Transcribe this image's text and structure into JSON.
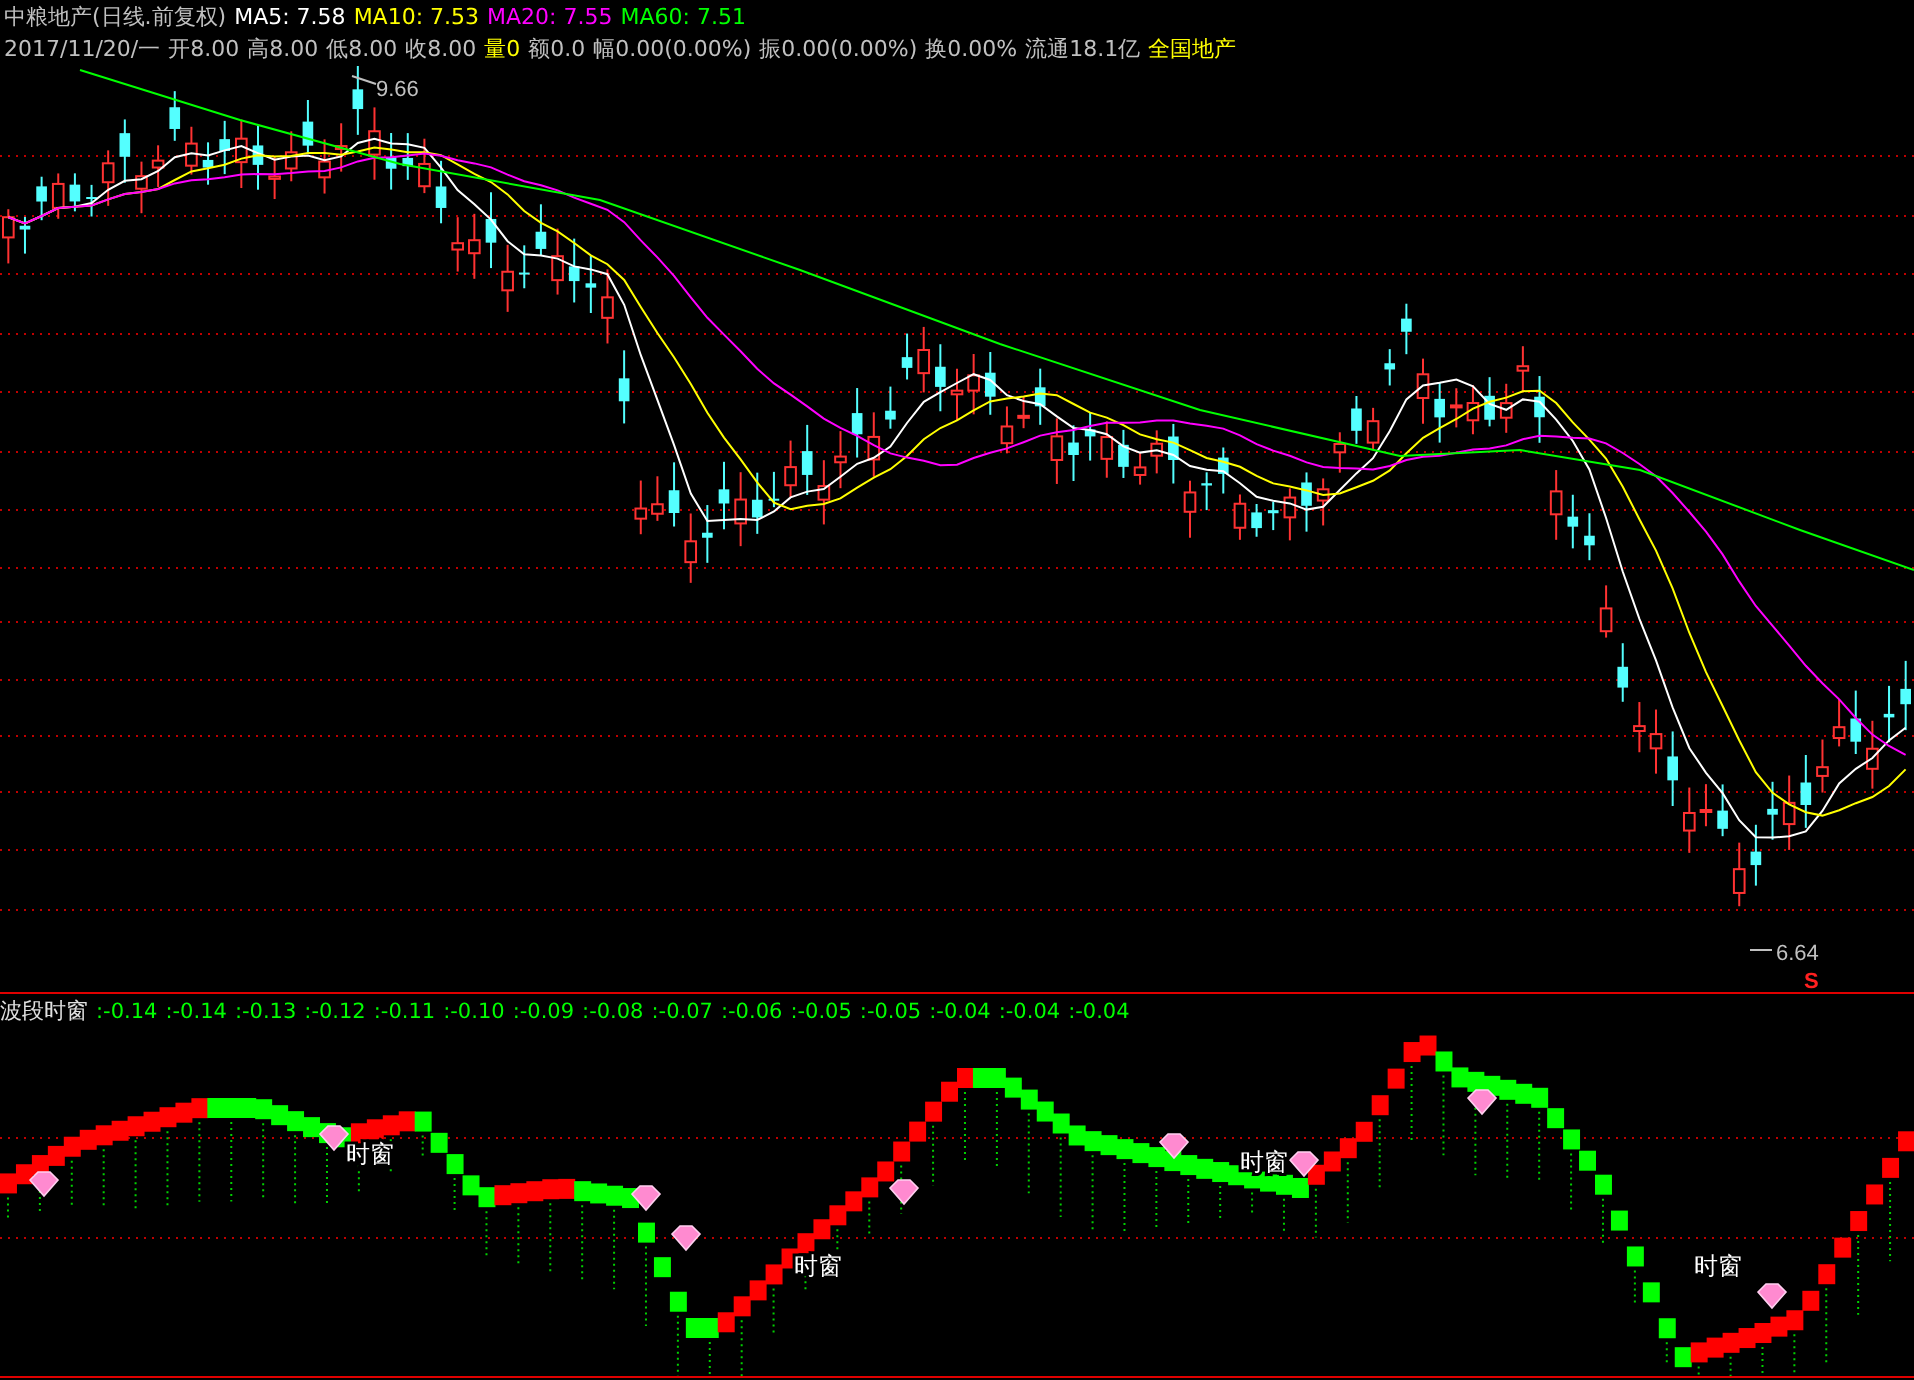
{
  "header": {
    "title": "中粮地产(日线.前复权)",
    "moving_averages": [
      {
        "label": "MA5: 7.58",
        "color": "#ffffff"
      },
      {
        "label": "MA10: 7.53",
        "color": "#ffff00"
      },
      {
        "label": "MA20: 7.55",
        "color": "#ff00ff"
      },
      {
        "label": "MA60: 7.51",
        "color": "#00ff00"
      }
    ],
    "quote": [
      {
        "text": "2017/11/20/一",
        "color": "#c0c0c0"
      },
      {
        "text": "开8.00",
        "color": "#c0c0c0"
      },
      {
        "text": "高8.00",
        "color": "#c0c0c0"
      },
      {
        "text": "低8.00",
        "color": "#c0c0c0"
      },
      {
        "text": "收8.00",
        "color": "#c0c0c0"
      },
      {
        "text": "量0",
        "color": "#ffff00"
      },
      {
        "text": "额0.0",
        "color": "#c0c0c0"
      },
      {
        "text": "幅0.00(0.00%)",
        "color": "#c0c0c0"
      },
      {
        "text": "振0.00(0.00%)",
        "color": "#c0c0c0"
      },
      {
        "text": "换0.00%",
        "color": "#c0c0c0"
      },
      {
        "text": "流通18.1亿",
        "color": "#c0c0c0"
      },
      {
        "text": "全国地产",
        "color": "#ffff00"
      }
    ]
  },
  "price_chart": {
    "high_label": "9.66",
    "low_label": "6.64",
    "signal": "S"
  },
  "indicator": {
    "title": "波段时窗",
    "values": [
      ":-0.14",
      ":-0.14",
      ":-0.13",
      ":-0.12",
      ":-0.11",
      ":-0.10",
      ":-0.09",
      ":-0.08",
      ":-0.07",
      ":-0.06",
      ":-0.05",
      ":-0.05",
      ":-0.04",
      ":-0.04",
      ":-0.04"
    ],
    "window_labels": [
      "时窗",
      "时窗",
      "时窗",
      "时窗"
    ]
  }
}
